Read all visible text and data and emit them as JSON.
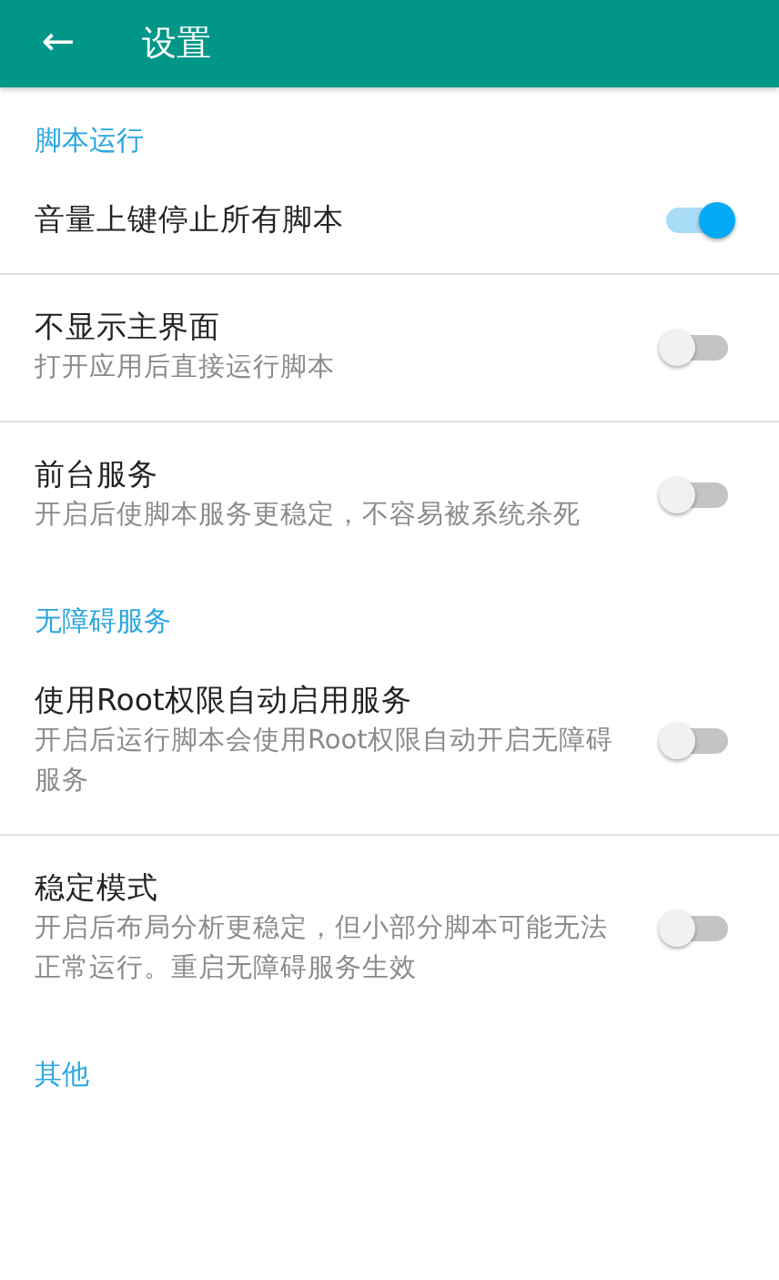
{
  "app_bar": {
    "back_glyph": "←",
    "title": "设置"
  },
  "sections": [
    {
      "title": "脚本运行",
      "items": [
        {
          "title": "音量上键停止所有脚本",
          "on": true
        },
        {
          "title": "不显示主界面",
          "summary": "打开应用后直接运行脚本",
          "on": false
        },
        {
          "title": "前台服务",
          "summary": "开启后使脚本服务更稳定，不容易被系统杀死",
          "on": false
        }
      ]
    },
    {
      "title": "无障碍服务",
      "items": [
        {
          "title": "使用Root权限自动启用服务",
          "summary": "开启后运行脚本会使用Root权限自动开启无障碍服务",
          "on": false
        },
        {
          "title": "稳定模式",
          "summary": "开启后布局分析更稳定，但小部分脚本可能无法正常运行。重启无障碍服务生效",
          "on": false
        }
      ]
    },
    {
      "title": "其他"
    }
  ]
}
